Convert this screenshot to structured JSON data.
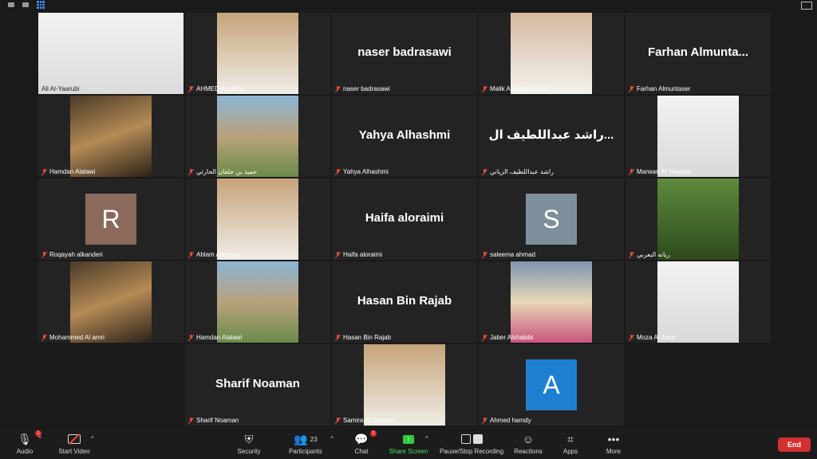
{
  "tiles": [
    {
      "label": "Ali Al-Yaarubi",
      "type": "video",
      "active": true,
      "muted": false
    },
    {
      "label": "AHMED ALHADI",
      "type": "photo",
      "muted": true
    },
    {
      "label": "naser badrasawi",
      "type": "name",
      "name": "naser badrasawi",
      "muted": true
    },
    {
      "label": "Malik Alghafri - NYC",
      "type": "photo",
      "muted": true
    },
    {
      "label": "Farhan Almuntaser",
      "type": "name",
      "name": "Farhan  Almunta...",
      "muted": true
    },
    {
      "label": "Hamdan Alalawi",
      "type": "photo",
      "muted": true
    },
    {
      "label": "حميد بن جلفان الحارثي",
      "type": "photo",
      "muted": true
    },
    {
      "label": "Yahya Alhashmi",
      "type": "name",
      "name": "Yahya Alhashmi",
      "muted": true
    },
    {
      "label": "راشد عبداللطيف الزياني",
      "type": "name",
      "name": "راشد عبداللطيف ال...",
      "muted": true
    },
    {
      "label": "Marwan Al Yaqoubi",
      "type": "photo",
      "muted": true
    },
    {
      "label": "Roqayah alkanderi",
      "type": "avatar",
      "avatar_letter": "R",
      "avatar_color": "#8b6a5c",
      "muted": true
    },
    {
      "label": "Ahlam Alkamici",
      "type": "photo",
      "muted": true
    },
    {
      "label": "Haifa aloraimi",
      "type": "name",
      "name": "Haifa aloraimi",
      "muted": true
    },
    {
      "label": "saleema ahmad",
      "type": "avatar",
      "avatar_letter": "S",
      "avatar_color": "#7d8f9b",
      "muted": true
    },
    {
      "label": "ريانه البعربي",
      "type": "photo",
      "muted": true
    },
    {
      "label": "Mohammed Al amri",
      "type": "photo",
      "muted": true
    },
    {
      "label": "Hamdan Alalawi",
      "type": "photo",
      "muted": true
    },
    {
      "label": "Hasan Bin Rajab",
      "type": "name",
      "name": "Hasan Bin Rajab",
      "muted": true
    },
    {
      "label": "Jaber Alshabibi",
      "type": "photo",
      "muted": true
    },
    {
      "label": "Moza Al Jabri",
      "type": "photo",
      "muted": true
    },
    {
      "label": "Sharif Noaman",
      "type": "name",
      "name": "Sharif Noaman",
      "muted": true
    },
    {
      "label": "Samira Al-Shukaili",
      "type": "photo",
      "muted": true
    },
    {
      "label": "Ahmed hamdy",
      "type": "avatar",
      "avatar_letter": "A",
      "avatar_color": "#1e7fd0",
      "muted": true
    }
  ],
  "toolbar": {
    "audio": "Audio",
    "start_video": "Start Video",
    "security": "Security",
    "participants": "Participants",
    "participants_count": "23",
    "chat": "Chat",
    "chat_badge": "1",
    "share_screen": "Share Screen",
    "recording": "Pause/Stop Recording",
    "reactions": "Reactions",
    "apps": "Apps",
    "more": "More",
    "end": "End"
  }
}
